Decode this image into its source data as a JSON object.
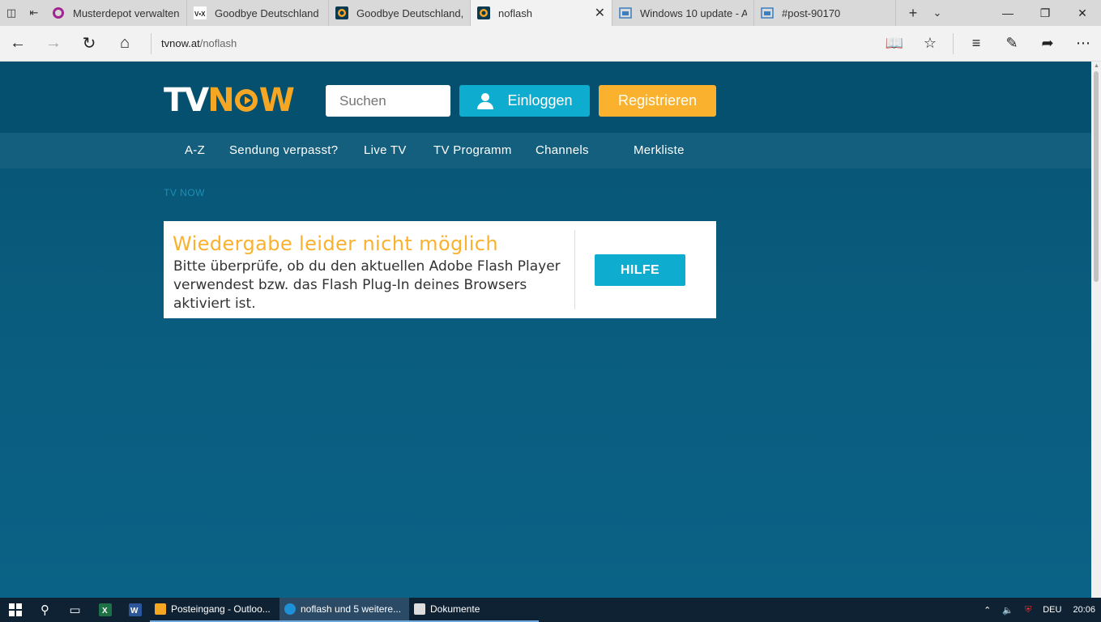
{
  "browser": {
    "tabs": [
      {
        "label": "Musterdepot verwalten",
        "icon": "circle-app-icon",
        "active": false
      },
      {
        "label": "Goodbye Deutschland",
        "icon": "vox-icon",
        "active": false
      },
      {
        "label": "Goodbye Deutschland,",
        "icon": "tvnow-icon",
        "active": false
      },
      {
        "label": "noflash",
        "icon": "tvnow-icon",
        "active": true
      },
      {
        "label": "Windows 10 update - A",
        "icon": "page-icon",
        "active": false
      },
      {
        "label": "#post-90170",
        "icon": "page-icon",
        "active": false
      }
    ],
    "url_host": "tvnow.at",
    "url_path": "/noflash"
  },
  "site": {
    "logo_tv": "TV",
    "logo_now": "N",
    "logo_w": "W",
    "search_placeholder": "Suchen",
    "login_label": "Einloggen",
    "register_label": "Registrieren",
    "nav": [
      "A-Z",
      "Sendung verpasst?",
      "Live TV",
      "TV Programm",
      "Channels",
      "Merkliste"
    ],
    "breadcrumb": "TV NOW",
    "notice": {
      "title": "Wiedergabe leider nicht möglich",
      "message": "Bitte überprüfe, ob du den aktuellen Adobe Flash Player verwendest bzw. das Flash Plug-In deines Browsers aktiviert ist.",
      "help_label": "HILFE"
    }
  },
  "taskbar": {
    "apps": [
      {
        "label": "Posteingang - Outloo...",
        "color": "#f5a623",
        "active": false
      },
      {
        "label": "noflash und 5 weitere...",
        "color": "#1e90d6",
        "active": true
      },
      {
        "label": "Dokumente",
        "color": "#dddddd",
        "active": false
      }
    ],
    "language": "DEU",
    "time": "20:06"
  },
  "colors": {
    "accent_orange": "#fab12d",
    "accent_cyan": "#0eadd0",
    "page_bg": "#0b5e7e"
  }
}
